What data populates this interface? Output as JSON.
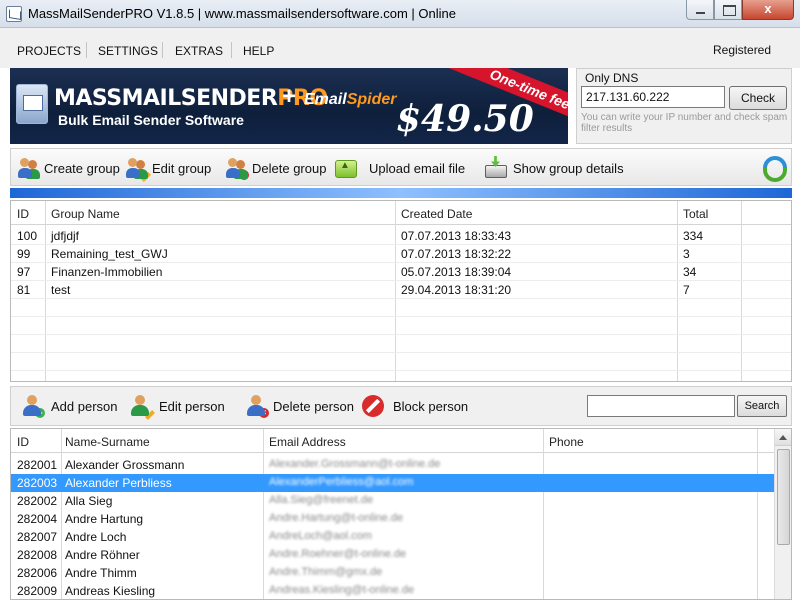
{
  "window": {
    "title": "MassMailSenderPRO V1.8.5 | www.massmailsendersoftware.com | Online",
    "close_label": "x"
  },
  "menu": {
    "items": [
      "PROJECTS",
      "SETTINGS",
      "EXTRAS",
      "HELP"
    ],
    "status": "Registered"
  },
  "banner": {
    "brand_main": "MASSMAILSENDER",
    "brand_pro": "PRO",
    "plus": "+",
    "addon_email": "Email",
    "addon_spider": "Spider",
    "tagline": "Bulk Email Sender Software",
    "price": "$49.50",
    "ribbon": "One-time fee"
  },
  "dns": {
    "legend": "Only DNS",
    "ip_value": "217.131.60.222",
    "check_label": "Check",
    "hint": "You can write your IP number and check spam filter results"
  },
  "group_toolbar": {
    "create": "Create group",
    "edit": "Edit group",
    "delete": "Delete group",
    "upload": "Upload email file",
    "details": "Show group details"
  },
  "groups_table": {
    "columns": [
      "ID",
      "Group Name",
      "Created Date",
      "Total"
    ],
    "rows": [
      {
        "id": "100",
        "name": "jdfjdjf",
        "created": "07.07.2013 18:33:43",
        "total": "334"
      },
      {
        "id": "99",
        "name": "Remaining_test_GWJ",
        "created": "07.07.2013 18:32:22",
        "total": "3"
      },
      {
        "id": "97",
        "name": "Finanzen-Immobilien",
        "created": "05.07.2013 18:39:04",
        "total": "34"
      },
      {
        "id": "81",
        "name": "test",
        "created": "29.04.2013 18:31:20",
        "total": "7"
      }
    ]
  },
  "person_toolbar": {
    "add": "Add person",
    "edit": "Edit person",
    "delete": "Delete person",
    "block": "Block person",
    "search_label": "Search",
    "search_value": ""
  },
  "persons_table": {
    "columns": [
      "ID",
      "Name-Surname",
      "Email Address",
      "Phone"
    ],
    "selected_index": 1,
    "rows": [
      {
        "id": "282001",
        "name": "Alexander Grossmann",
        "email": "Alexander.Grossmann@t-online.de",
        "phone": ""
      },
      {
        "id": "282003",
        "name": "Alexander Perbliess",
        "email": "AlexanderPerbliess@aol.com",
        "phone": ""
      },
      {
        "id": "282002",
        "name": "Alla Sieg",
        "email": "Alla.Sieg@freenet.de",
        "phone": ""
      },
      {
        "id": "282004",
        "name": "Andre Hartung",
        "email": "Andre.Hartung@t-online.de",
        "phone": ""
      },
      {
        "id": "282007",
        "name": "Andre Loch",
        "email": "AndreLoch@aol.com",
        "phone": ""
      },
      {
        "id": "282008",
        "name": "Andre Röhner",
        "email": "Andre.Roehner@t-online.de",
        "phone": ""
      },
      {
        "id": "282006",
        "name": "Andre Thimm",
        "email": "Andre.Thimm@gmx.de",
        "phone": ""
      },
      {
        "id": "282009",
        "name": "Andreas Kiesling",
        "email": "Andreas.Kiesling@t-online.de",
        "phone": ""
      }
    ]
  },
  "colors": {
    "selection": "#3399ff",
    "banner_bg": "#13264a",
    "accent_orange": "#ff9a1f",
    "ribbon_red": "#d6142b",
    "stripe_blue": "#1d67d6"
  },
  "icons": {
    "create": "people-add-icon",
    "edit": "people-edit-icon",
    "delete": "people-delete-icon",
    "upload": "upload-file-icon",
    "details": "printer-details-icon",
    "refresh": "refresh-icon",
    "add_person": "person-add-icon",
    "edit_person": "person-edit-icon",
    "delete_person": "person-delete-icon",
    "block_person": "block-icon"
  }
}
